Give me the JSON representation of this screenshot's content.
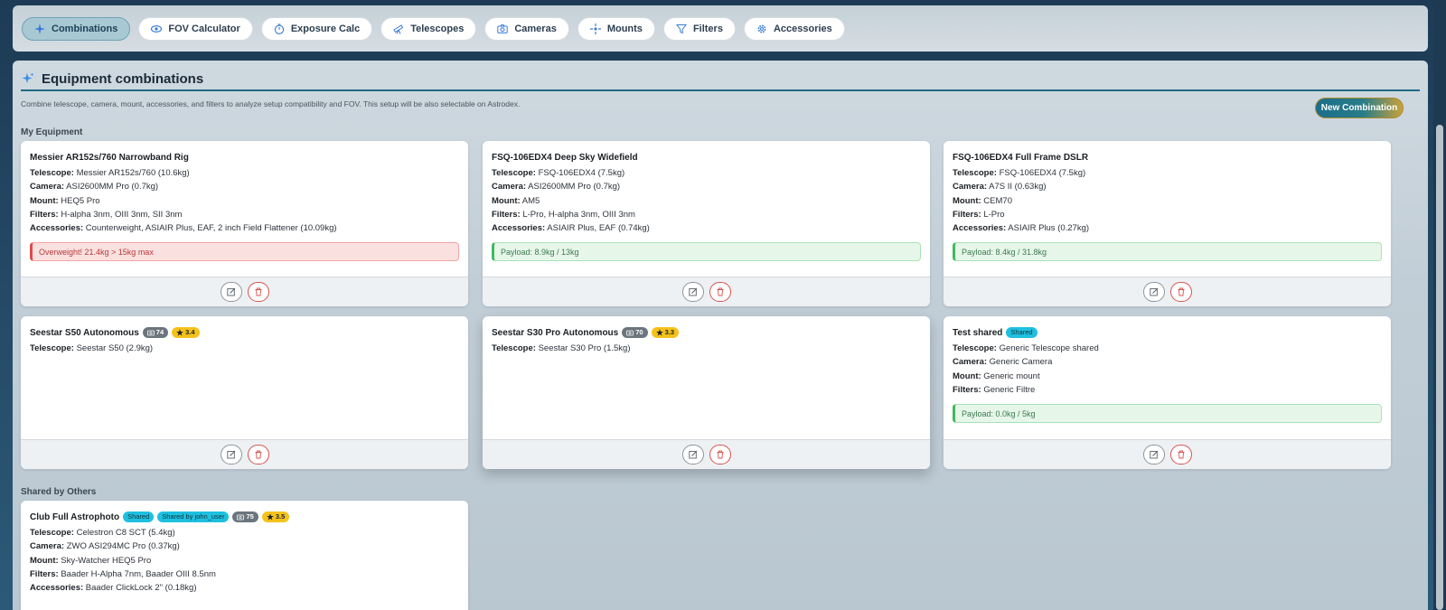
{
  "tabs": [
    {
      "label": "Combinations",
      "icon": "sparkle-icon",
      "active": true
    },
    {
      "label": "FOV Calculator",
      "icon": "eye-icon",
      "active": false
    },
    {
      "label": "Exposure Calc",
      "icon": "stopwatch-icon",
      "active": false
    },
    {
      "label": "Telescopes",
      "icon": "telescope-icon",
      "active": false
    },
    {
      "label": "Cameras",
      "icon": "camera-icon",
      "active": false
    },
    {
      "label": "Mounts",
      "icon": "crosshair-icon",
      "active": false
    },
    {
      "label": "Filters",
      "icon": "funnel-icon",
      "active": false
    },
    {
      "label": "Accessories",
      "icon": "gear-icon",
      "active": false
    }
  ],
  "header": {
    "title": "Equipment combinations",
    "description": "Combine telescope, camera, mount, accessories, and filters to analyze setup compatibility and FOV. This setup will be also selectable on Astrodex.",
    "new_button": "New Combination"
  },
  "sections": {
    "mine": "My Equipment",
    "others": "Shared by Others"
  },
  "labels": {
    "telescope": "Telescope:",
    "camera": "Camera:",
    "mount": "Mount:",
    "filters": "Filters:",
    "accessories": "Accessories:"
  },
  "cards": [
    {
      "title": "Messier AR152s/760 Narrowband Rig",
      "telescope": "Messier AR152s/760 (10.6kg)",
      "camera": "ASI2600MM Pro (0.7kg)",
      "mount": "HEQ5 Pro",
      "filters": "H-alpha 3nm, OIII 3nm, SII 3nm",
      "accessories": "Counterweight, ASIAIR Plus, EAF, 2 inch Field Flattener (10.09kg)",
      "status": "Overweight! 21.4kg > 15kg max"
    },
    {
      "title": "FSQ-106EDX4 Deep Sky Widefield",
      "telescope": "FSQ-106EDX4 (7.5kg)",
      "camera": "ASI2600MM Pro (0.7kg)",
      "mount": "AM5",
      "filters": "L-Pro, H-alpha 3nm, OIII 3nm",
      "accessories": "ASIAIR Plus, EAF (0.74kg)",
      "status": "Payload: 8.9kg / 13kg"
    },
    {
      "title": "FSQ-106EDX4 Full Frame DSLR",
      "telescope": "FSQ-106EDX4 (7.5kg)",
      "camera": "A7S II (0.63kg)",
      "mount": "CEM70",
      "filters": "L-Pro",
      "accessories": "ASIAIR Plus (0.27kg)",
      "status": "Payload: 8.4kg / 31.8kg"
    },
    {
      "title": "Seestar S50 Autonomous",
      "count": "74",
      "rating": "3.4",
      "telescope": "Seestar S50 (2.9kg)"
    },
    {
      "title": "Seestar S30 Pro Autonomous",
      "count": "70",
      "rating": "3.3",
      "telescope": "Seestar S30 Pro (1.5kg)"
    },
    {
      "title": "Test shared",
      "shared": "Shared",
      "telescope": "Generic Telescope shared",
      "camera": "Generic Camera",
      "mount": "Generic mount",
      "filters": "Generic Filtre",
      "status": "Payload: 0.0kg / 5kg"
    },
    {
      "title": "Club Full Astrophoto",
      "shared": "Shared",
      "shared_by": "Shared by john_user",
      "count": "75",
      "rating": "3.5",
      "telescope": "Celestron C8 SCT (5.4kg)",
      "camera": "ZWO ASI294MC Pro (0.37kg)",
      "mount": "Sky-Watcher HEQ5 Pro",
      "filters": "Baader H-Alpha 7nm, Baader OIII 8.5nm",
      "accessories": "Baader ClickLock 2\" (0.18kg)"
    }
  ],
  "colors": {
    "accent": "#1f6a84",
    "danger": "#d9534f",
    "success": "#3fb85f",
    "rating": "#f5c21b",
    "shared": "#1ec0e0"
  }
}
